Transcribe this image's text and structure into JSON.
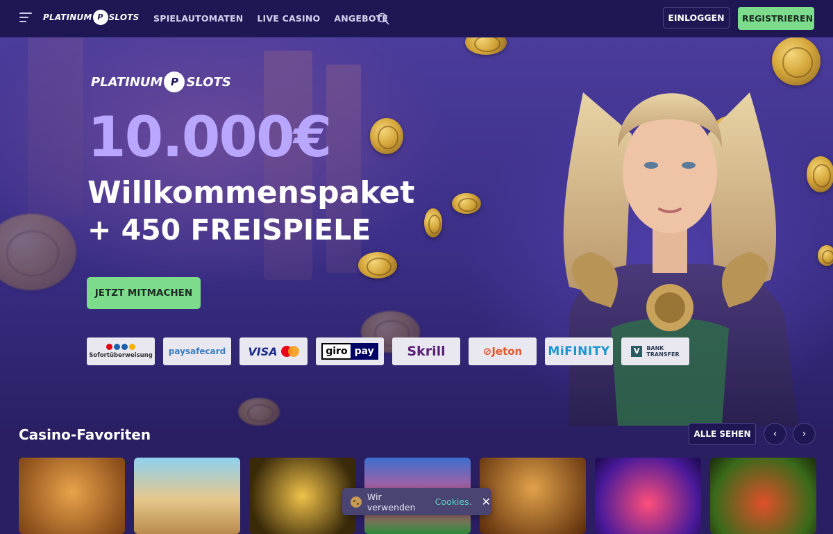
{
  "header": {
    "logo": "PLATINUM SLOTS",
    "nav": [
      {
        "label": "SPIELAUTOMATEN"
      },
      {
        "label": "LIVE CASINO"
      },
      {
        "label": "ANGEBOTE"
      }
    ],
    "login_label": "EINLOGGEN",
    "register_label": "REGISTRIEREN",
    "icons": {
      "menu": "menu-icon",
      "search": "search-icon"
    }
  },
  "hero": {
    "logo": "PLATINUM SLOTS",
    "amount": "10.000€",
    "line1": "Willkommenspaket",
    "line2": "+ 450 FREISPIELE",
    "cta_label": "JETZT MITMACHEN",
    "payments": {
      "sofort": "Sofortüberweisung",
      "paysafecard": "paysafecard",
      "visa": "VISA",
      "giropay_a": "giro",
      "giropay_b": "pay",
      "skrill": "Skrill",
      "jeton": "Jeton",
      "mifinity": "MiFINITY",
      "bank_1": "BANK",
      "bank_2": "TRANSFER"
    }
  },
  "favorites": {
    "title": "Casino-Favoriten",
    "see_all_label": "ALLE SEHEN",
    "prev_icon": "chevron-left-icon",
    "next_icon": "chevron-right-icon"
  },
  "cookie": {
    "text": "Wir verwenden",
    "link": "Cookies."
  },
  "colors": {
    "accent_green": "#7ddc8c",
    "header_bg": "#1e1754",
    "bonus_purple": "#b9a6ff",
    "cookie_link": "#5ad4c2"
  }
}
